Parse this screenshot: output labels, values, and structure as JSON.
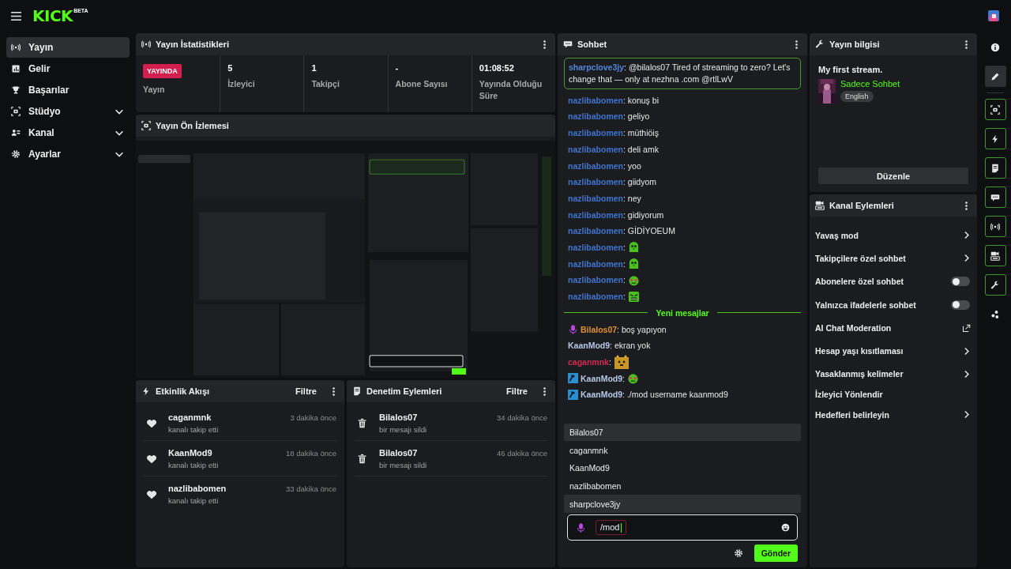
{
  "topbar": {
    "logo": "KICK",
    "badge": "BETA"
  },
  "sidebar": {
    "items": [
      {
        "label": "Yayın",
        "selected": true,
        "expandable": false
      },
      {
        "label": "Gelir",
        "selected": false,
        "expandable": false
      },
      {
        "label": "Başarılar",
        "selected": false,
        "expandable": false
      },
      {
        "label": "Stüdyo",
        "selected": false,
        "expandable": true
      },
      {
        "label": "Kanal",
        "selected": false,
        "expandable": true
      },
      {
        "label": "Ayarlar",
        "selected": false,
        "expandable": true
      }
    ]
  },
  "stats": {
    "title": "Yayın İstatistikleri",
    "live_badge": "YAYINDA",
    "cells": [
      {
        "label": "Yayın"
      },
      {
        "value": "5",
        "label": "İzleyici"
      },
      {
        "value": "1",
        "label": "Takipçi"
      },
      {
        "value": "-",
        "label": "Abone Sayısı"
      },
      {
        "value": "01:08:52",
        "label": "Yayında Olduğu Süre"
      }
    ]
  },
  "preview": {
    "title": "Yayın Ön İzlemesi"
  },
  "activity": {
    "title": "Etkinlik Akışı",
    "filter": "Filtre",
    "events": [
      {
        "user": "caganmnk",
        "action": "kanalı takip etti",
        "time": "3 dakika önce"
      },
      {
        "user": "KaanMod9",
        "action": "kanalı takip etti",
        "time": "18 dakika önce"
      },
      {
        "user": "nazlibabomen",
        "action": "kanalı takip etti",
        "time": "33 dakika önce"
      }
    ]
  },
  "moderation": {
    "title": "Denetim Eylemleri",
    "filter": "Filtre",
    "events": [
      {
        "user": "Bilalos07",
        "action": "bir mesajı sildi",
        "time": "34 dakika önce"
      },
      {
        "user": "Bilalos07",
        "action": "bir mesajı sildi",
        "time": "46 dakika önce"
      }
    ]
  },
  "chat": {
    "title": "Sohbet",
    "pinned": {
      "user": "sharpclove3jy",
      "text": ": @bilalos07 Tired of streaming to zero? Let's change that — only at nezhna .com @rtlLwV",
      "color": "#4f86dc"
    },
    "messages": [
      {
        "user": "nazlibabomen",
        "kind": "text",
        "text": ": konuş bi",
        "color": "#3f74cf"
      },
      {
        "user": "nazlibabomen",
        "kind": "text",
        "text": ": geliyo",
        "color": "#3f74cf"
      },
      {
        "user": "nazlibabomen",
        "kind": "text",
        "text": ": müthiöiş",
        "color": "#3f74cf"
      },
      {
        "user": "nazlibabomen",
        "kind": "text",
        "text": ": deli amk",
        "color": "#3f74cf"
      },
      {
        "user": "nazlibabomen",
        "kind": "text",
        "text": ": yoo",
        "color": "#3f74cf"
      },
      {
        "user": "nazlibabomen",
        "kind": "text",
        "text": ": giidyom",
        "color": "#3f74cf"
      },
      {
        "user": "nazlibabomen",
        "kind": "text",
        "text": ": ney",
        "color": "#3f74cf"
      },
      {
        "user": "nazlibabomen",
        "kind": "text",
        "text": ": gidiyorum",
        "color": "#3f74cf"
      },
      {
        "user": "nazlibabomen",
        "kind": "text",
        "text": ": GİDİYOEUM",
        "color": "#3f74cf"
      },
      {
        "user": "nazlibabomen",
        "kind": "emote",
        "text": ":",
        "color": "#3f74cf"
      },
      {
        "user": "nazlibabomen",
        "kind": "emote",
        "text": ":",
        "color": "#3f74cf"
      },
      {
        "user": "nazlibabomen",
        "kind": "emote",
        "text": ":",
        "color": "#3f74cf"
      },
      {
        "user": "nazlibabomen",
        "kind": "emote",
        "text": ":",
        "color": "#3f74cf"
      }
    ],
    "divider": "Yeni mesajlar",
    "new_messages": [
      {
        "user": "Bilalos07",
        "kind": "text",
        "text": ": boş yapıyon",
        "color": "#e0922f",
        "broadcaster": true
      },
      {
        "user": "KaanMod9",
        "kind": "text",
        "text": ": ekran yok",
        "color": "#b4c8e8"
      },
      {
        "user": "caganmnk",
        "kind": "emote",
        "text": ":",
        "color": "#d42a52"
      },
      {
        "user": "KaanMod9",
        "kind": "emote",
        "text": ":",
        "color": "#b4c8e8",
        "moderator": true
      },
      {
        "user": "KaanMod9",
        "kind": "text",
        "text": ": ./mod username kaanmod9",
        "color": "#b4c8e8",
        "moderator": true
      }
    ],
    "suggestions": [
      {
        "label": "Bilalos07",
        "selected": true
      },
      {
        "label": "caganmnk",
        "selected": false
      },
      {
        "label": "KaanMod9",
        "selected": false
      },
      {
        "label": "nazlibabomen",
        "selected": false
      },
      {
        "label": "sharpclove3jy",
        "selected": true
      }
    ],
    "input": {
      "value": "/mod"
    },
    "send": "Gönder"
  },
  "info": {
    "title": "Yayın bilgisi",
    "stream_title": "My first stream.",
    "category": "Sadece Sohbet",
    "language": "English",
    "edit": "Düzenle"
  },
  "channel_actions": {
    "title": "Kanal Eylemleri",
    "items": [
      {
        "label": "Yavaş mod",
        "kind": "link"
      },
      {
        "label": "Takipçilere özel sohbet",
        "kind": "link"
      },
      {
        "label": "Abonelere özel sohbet",
        "kind": "toggle",
        "on": false
      },
      {
        "label": "Yalnızca ifadelerle sohbet",
        "kind": "toggle",
        "on": false
      },
      {
        "label": "AI Chat Moderation",
        "kind": "external"
      },
      {
        "label": "Hesap yaşı kısıtlaması",
        "kind": "link"
      },
      {
        "label": "Yasaklanmış kelimeler",
        "kind": "link"
      },
      {
        "label": "İzleyici Yönlendir",
        "kind": "plain"
      },
      {
        "label": "Hedefleri belirleyin",
        "kind": "link"
      }
    ]
  },
  "rail": {
    "items": [
      {
        "selected": false,
        "active": false
      },
      {
        "selected": true,
        "active": false
      },
      {
        "selected": false,
        "active": true
      },
      {
        "selected": false,
        "active": true
      },
      {
        "selected": false,
        "active": true
      },
      {
        "selected": false,
        "active": true
      },
      {
        "selected": false,
        "active": true
      },
      {
        "selected": false,
        "active": true
      },
      {
        "selected": false,
        "active": true
      },
      {
        "selected": false,
        "active": false
      }
    ]
  }
}
